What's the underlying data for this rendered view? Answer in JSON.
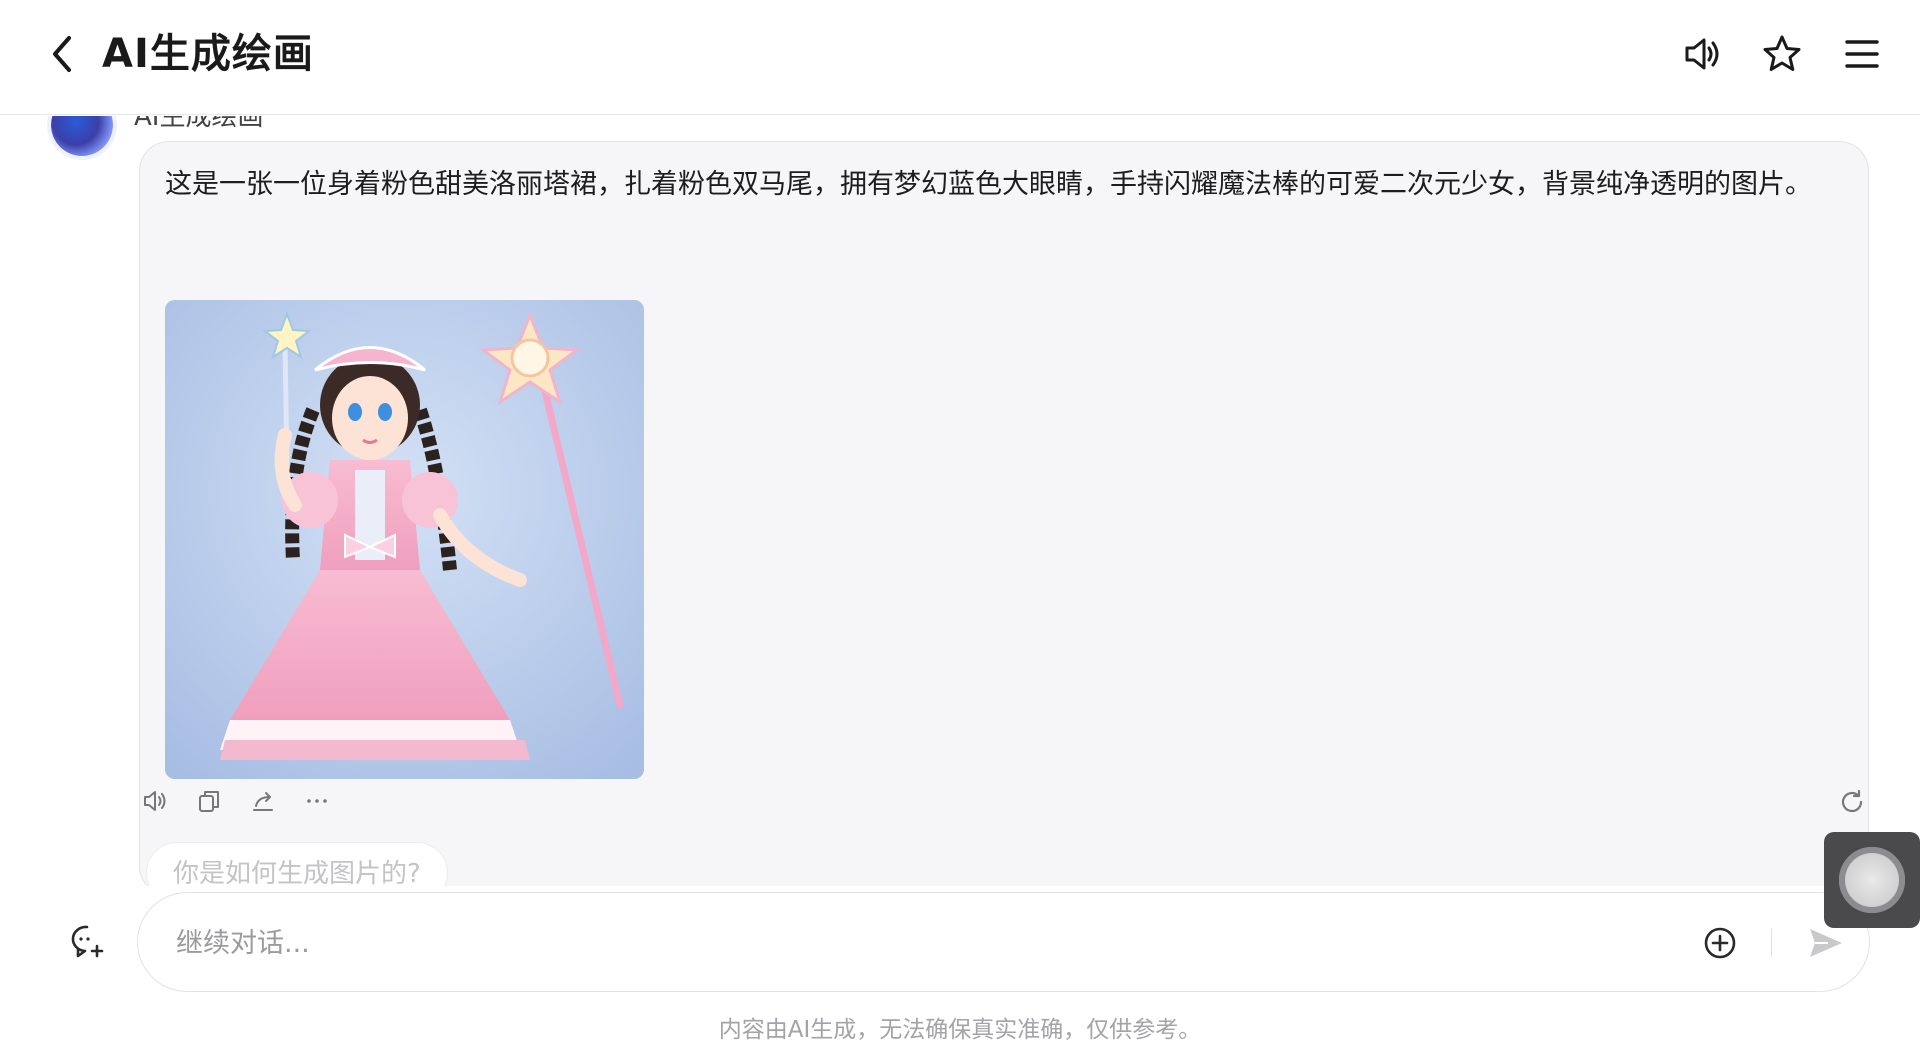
{
  "header": {
    "title": "AI生成绘画"
  },
  "bot": {
    "name": "AI生成绘画"
  },
  "message": {
    "text": "这是一张一位身着粉色甜美洛丽塔裙，扎着粉色双马尾，拥有梦幻蓝色大眼睛，手持闪耀魔法棒的可爱二次元少女，背景纯净透明的图片。",
    "image_alt": "粉色洛丽塔裙少女手持魔法棒"
  },
  "suggestion": {
    "text": "你是如何生成图片的?"
  },
  "input": {
    "placeholder": "继续对话..."
  },
  "footer": {
    "disclaimer": "内容由AI生成，无法确保真实准确，仅供参考。"
  },
  "icons": {
    "back": "chevron-left-icon",
    "speaker": "speaker-icon",
    "favorite": "star-icon",
    "menu": "hamburger-menu-icon",
    "copy": "copy-icon",
    "share": "share-icon",
    "more": "more-dots-icon",
    "regenerate": "refresh-icon",
    "new_chat": "new-chat-icon",
    "add": "plus-circle-icon",
    "send": "send-icon"
  },
  "colors": {
    "bubble_bg": "#f6f6f8",
    "accent_dress": "#f4a9c4",
    "image_bg": "#b7cbeb"
  }
}
